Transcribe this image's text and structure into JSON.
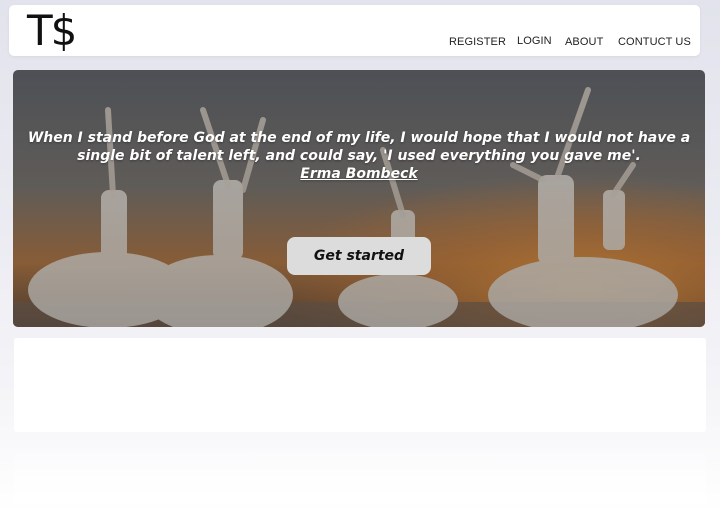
{
  "brand": {
    "logo": "T$"
  },
  "nav": {
    "register": "REGISTER",
    "login": "LOGIN",
    "about": "ABOUT",
    "contact": "CONTUCT US"
  },
  "hero": {
    "quote_line1": "When I stand before God at the end of my life, I would hope that I would not have a",
    "quote_line2": "single bit of talent left, and could say, 'I used everything you gave me'.",
    "author": "Erma Bombeck",
    "cta_label": "Get started"
  }
}
